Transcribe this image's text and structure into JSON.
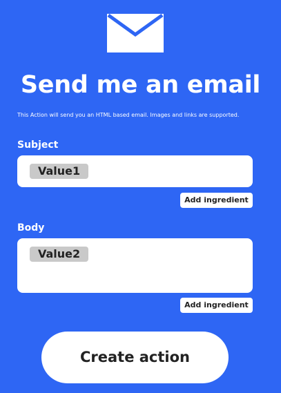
{
  "header": {
    "icon": "envelope-icon",
    "title": "Send me an email",
    "description": "This Action will send you an HTML based email. Images and links are supported."
  },
  "fields": {
    "subject": {
      "label": "Subject",
      "value": "Value1",
      "add_label": "Add ingredient"
    },
    "body": {
      "label": "Body",
      "value": "Value2",
      "add_label": "Add ingredient"
    }
  },
  "actions": {
    "create_label": "Create action"
  },
  "colors": {
    "background": "#2e66f4",
    "surface": "#ffffff",
    "ingredient_pill": "#c9c9c9",
    "text_dark": "#222222"
  }
}
